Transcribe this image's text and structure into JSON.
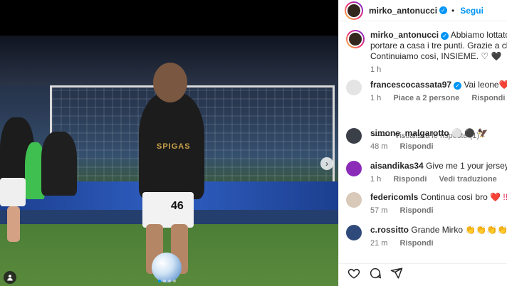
{
  "post": {
    "username": "mirko_antonucci",
    "follow_label": "Segui",
    "separator": "•",
    "caption_lines": [
      "Abbiamo lottato fino all'u",
      "portare a casa i tre punti. Grazie a chi ci suppo",
      "Continuiamo così, INSIEME. ♡ 🖤"
    ],
    "caption_time": "1 h",
    "jersey_number": "46",
    "sponsor_text": "SPIGAS"
  },
  "comments": [
    {
      "username": "francescocassata97",
      "verified": true,
      "text": "Vai leone",
      "emoji": "❤️❤️❤️",
      "time": "1 h",
      "likes": "Piace a 2 persone",
      "reply": "Rispondi",
      "view_replies": "Visualizza le risposte (1)"
    },
    {
      "username": "simone_malgarotto",
      "text": "⚪ ⚫ 🦅",
      "time": "48 m",
      "reply": "Rispondi"
    },
    {
      "username": "aisandikas34",
      "text": "Give me 1 your jersey bro in inc",
      "time": "1 h",
      "reply": "Rispondi",
      "translate": "Vedi traduzione"
    },
    {
      "username": "federicomls",
      "text": "Continua così bro",
      "emoji": "❤️ !!!!",
      "time": "57 m",
      "reply": "Rispondi"
    },
    {
      "username": "c.rossitto",
      "text": "Grande Mirko",
      "emoji": "👏👏👏👏💪",
      "time": "21 m",
      "reply": "Rispondi"
    }
  ],
  "carousel": {
    "count": 4,
    "active": 0
  },
  "colors": {
    "accent": "#0095f6",
    "muted": "#737373",
    "text": "#262626"
  },
  "icons": {
    "like": "heart-icon",
    "comment": "comment-icon",
    "share": "share-icon",
    "next": "chevron-right-icon",
    "tag": "user-tag-icon"
  }
}
